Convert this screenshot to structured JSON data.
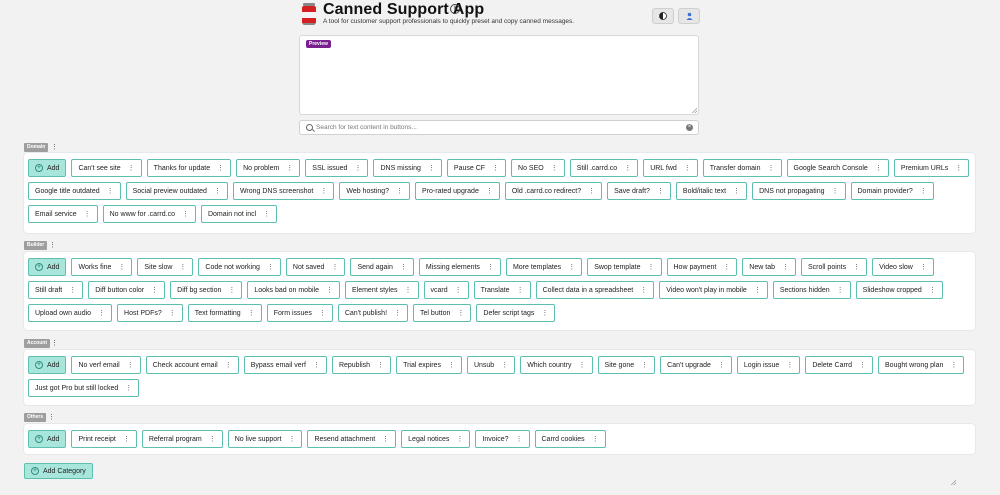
{
  "app": {
    "title": "Canned Support App",
    "subtitle": "A tool for customer support professionals to quickly preset and copy canned messages."
  },
  "preview": {
    "label": "Preview"
  },
  "search": {
    "placeholder": "Search for text content in buttons...",
    "value": ""
  },
  "add_label": "Add",
  "add_category_label": "Add Category",
  "menu_glyph": "⋮",
  "categories": [
    {
      "name": "Domain",
      "buttons": [
        "Can't see site",
        "Thanks for update",
        "No problem",
        "SSL issued",
        "DNS missing",
        "Pause CF",
        "No SEO",
        "Still .carrd.co",
        "URL fwd",
        "Transfer domain",
        "Google Search Console",
        "Premium URLs",
        "Google title outdated",
        "Social preview outdated",
        "Wrong DNS screenshot",
        "Web hosting?",
        "Pro-rated upgrade",
        "Old .carrd.co redirect?",
        "Save draft?",
        "Bold/italic text",
        "DNS not propagating",
        "Domain provider?",
        "Email service",
        "No www for .carrd.co",
        "Domain not incl"
      ]
    },
    {
      "name": "Builder",
      "buttons": [
        "Works fine",
        "Site slow",
        "Code not working",
        "Not saved",
        "Send again",
        "Missing elements",
        "More templates",
        "Swop template",
        "How payment",
        "New tab",
        "Scroll points",
        "Video slow",
        "Still draft",
        "Diff button color",
        "Diff bg section",
        "Looks bad on mobile",
        "Element styles",
        "vcard",
        "Translate",
        "Collect data in a spreadsheet",
        "Video won't play in mobile",
        "Sections hidden",
        "Slideshow cropped",
        "Upload own audio",
        "Host PDFs?",
        "Text formatting",
        "Form issues",
        "Can't publish!",
        "Tel button",
        "Defer script tags"
      ]
    },
    {
      "name": "Account",
      "buttons": [
        "No verf email",
        "Check account email",
        "Bypass email verf",
        "Republish",
        "Trial expires",
        "Unsub",
        "Which country",
        "Site gone",
        "Can't upgrade",
        "Login issue",
        "Delete Carrd",
        "Bought wrong plan",
        "Just got Pro but still locked"
      ]
    },
    {
      "name": "Others",
      "buttons": [
        "Print receipt",
        "Referral program",
        "No live support",
        "Resend attachment",
        "Legal notices",
        "Invoice?",
        "Carrd cookies"
      ]
    }
  ]
}
